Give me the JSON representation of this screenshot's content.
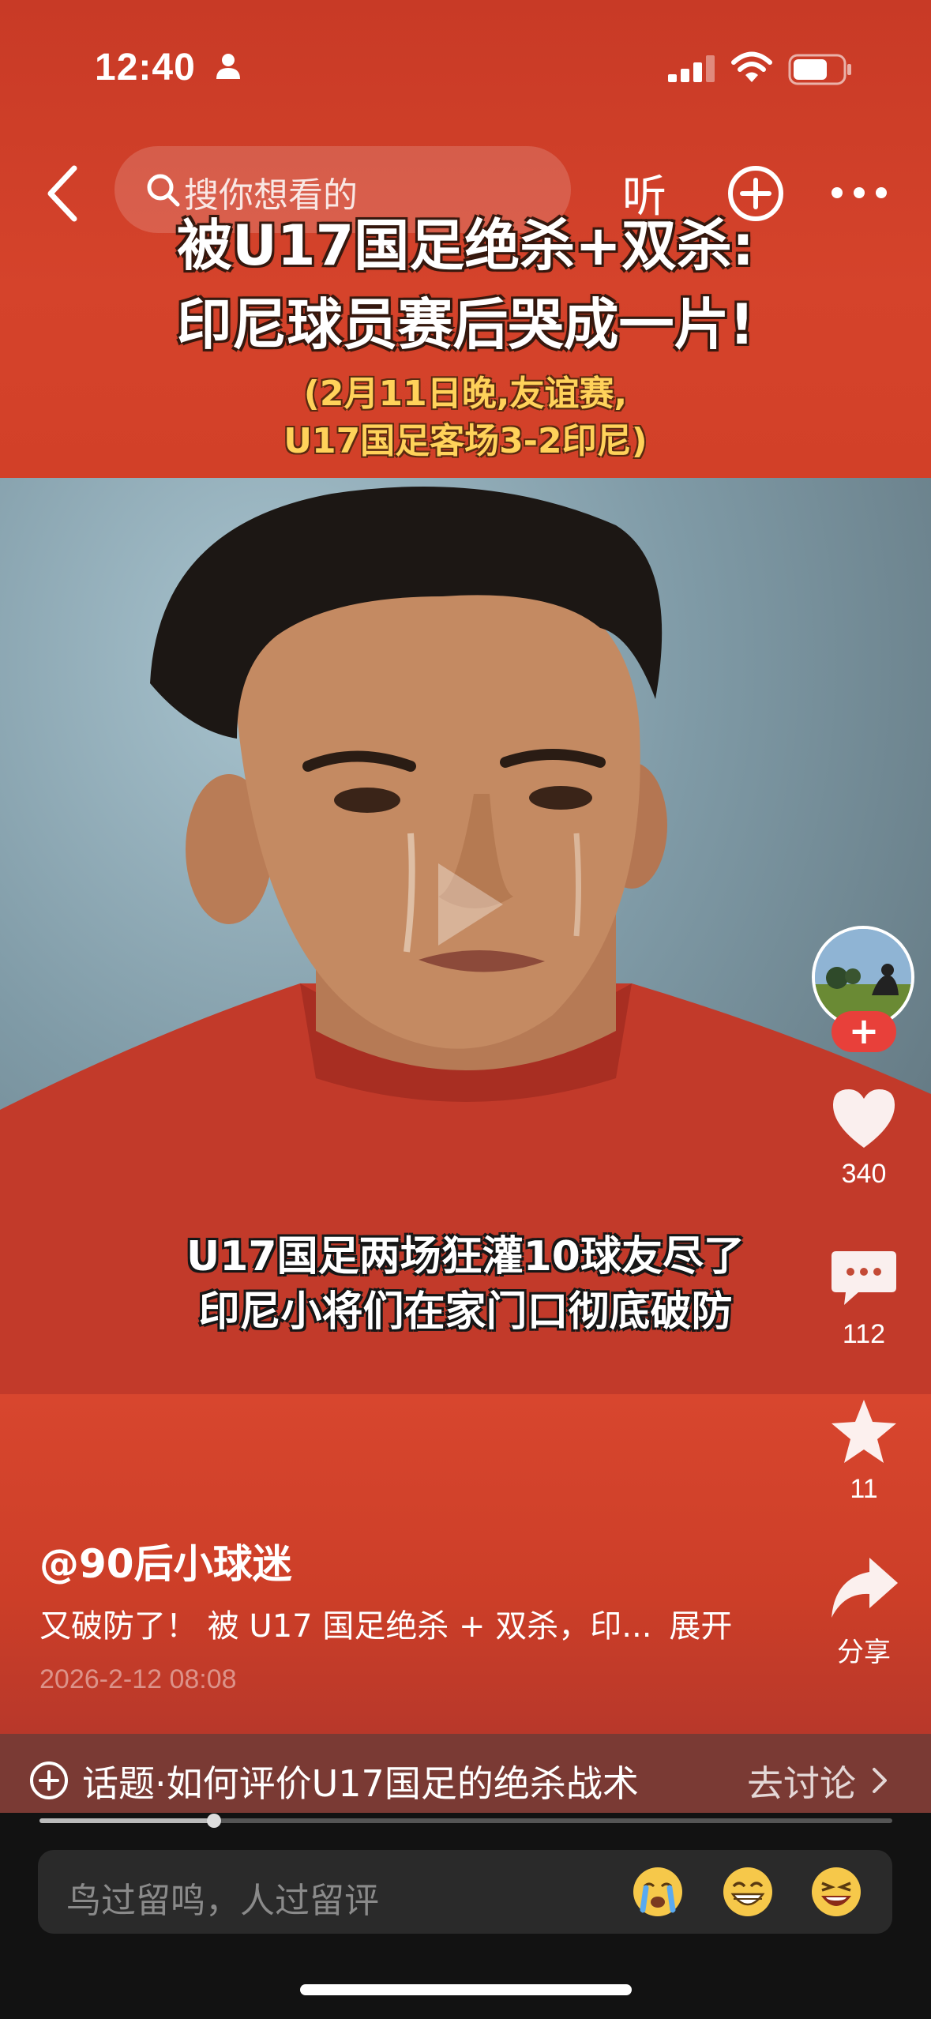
{
  "status_bar": {
    "time": "12:40"
  },
  "nav": {
    "search_placeholder": "搜你想看的",
    "listen_label": "听"
  },
  "video": {
    "headline_line1": "被U17国足绝杀+双杀:",
    "headline_line2": "印尼球员赛后哭成一片!",
    "subhead_line1": "(2月11日晚,友谊赛,",
    "subhead_line2": "U17国足客场3-2印尼)",
    "caption_line1": "U17国足两场狂灌10球友尽了",
    "caption_line2": "印尼小将们在家门口彻底破防",
    "progress": 0.205
  },
  "actions": {
    "follow_symbol": "+",
    "like_count": "340",
    "comment_count": "112",
    "favorite_count": "11",
    "share_label": "分享"
  },
  "post": {
    "author": "@90后小球迷",
    "description": "又破防了！ 被 U17 国足绝杀 + 双杀，印...",
    "expand_label": "展开",
    "date": "2026-2-12 08:08"
  },
  "topic": {
    "text": "话题·如何评价U17国足的绝杀战术",
    "link_label": "去讨论"
  },
  "comment_bar": {
    "placeholder": "鸟过留鸣，人过留评"
  },
  "colors": {
    "brand_red": "#d5432b",
    "follow_red": "#e8403a",
    "subhead_yellow": "#ffd25a"
  },
  "icons": [
    "person-icon",
    "signal-icon",
    "wifi-icon",
    "battery-icon",
    "back-icon",
    "search-icon",
    "add-circle-icon",
    "more-icon",
    "play-icon",
    "heart-icon",
    "comment-icon",
    "star-icon",
    "share-icon",
    "topic-plus-icon",
    "chevron-right-icon",
    "crying-emoji-icon",
    "grin-emoji-icon",
    "laugh-emoji-icon"
  ]
}
